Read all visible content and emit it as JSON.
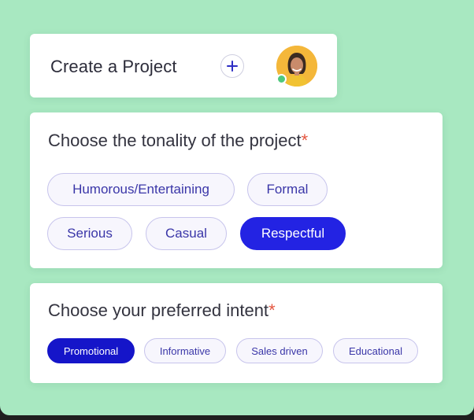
{
  "header": {
    "title": "Create a Project",
    "add_icon": "plus-icon",
    "avatar_icon": "user-avatar",
    "status": "online",
    "status_color": "#4fc87d"
  },
  "tonality": {
    "title": "Choose the tonality of the project",
    "required_mark": "*",
    "options": [
      "Humorous/Entertaining",
      "Formal",
      "Serious",
      "Casual",
      "Respectful"
    ],
    "selected": "Respectful"
  },
  "intent": {
    "title": "Choose your preferred intent",
    "required_mark": "*",
    "options": [
      "Promotional",
      "Informative",
      "Sales driven",
      "Educational"
    ],
    "selected": "Promotional"
  },
  "colors": {
    "background": "#a8e8c1",
    "accent": "#2323e3",
    "required": "#e4553f"
  }
}
